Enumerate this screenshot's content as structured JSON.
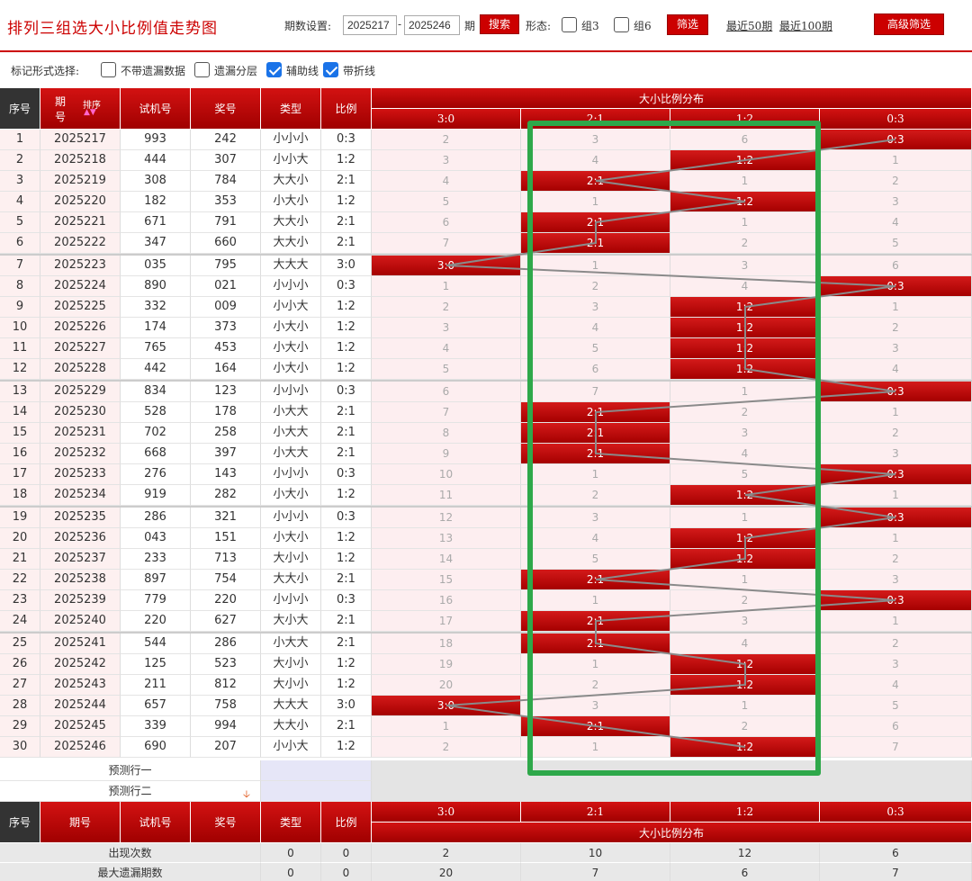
{
  "app": {
    "title": "排列三组选大小比例值走势图"
  },
  "filters": {
    "period_label": "期数设置:",
    "start": "2025217",
    "dash": "-",
    "end": "2025246",
    "unit": "期",
    "search_label": "搜索",
    "form_label": "形态:",
    "g3_label": "组3",
    "g6_label": "组6",
    "filter_label": "筛选",
    "recent50": "最近50期",
    "recent100": "最近100期",
    "advanced": "高级筛选"
  },
  "options": {
    "label": "标记形式选择:",
    "items": [
      {
        "label": "不带遗漏数据",
        "checked": false
      },
      {
        "label": "遗漏分层",
        "checked": false
      },
      {
        "label": "辅助线",
        "checked": true
      },
      {
        "label": "带折线",
        "checked": true
      }
    ]
  },
  "header": {
    "seq": "序号",
    "period_top": "期",
    "period_bottom": "号",
    "sort": "排序",
    "test": "试机号",
    "draw": "奖号",
    "type": "类型",
    "ratio": "比例",
    "dist": "大小比例分布",
    "cols": [
      "3:0",
      "2:1",
      "1:2",
      "0:3"
    ]
  },
  "rows": [
    {
      "seq": "1",
      "period": "2025217",
      "test": "993",
      "draw": "242",
      "type": "小小小",
      "ratio": "0:3",
      "cells": [
        "2",
        "3",
        "6",
        "0:3"
      ],
      "hit": 3
    },
    {
      "seq": "2",
      "period": "2025218",
      "test": "444",
      "draw": "307",
      "type": "小小大",
      "ratio": "1:2",
      "cells": [
        "3",
        "4",
        "1:2",
        "1"
      ],
      "hit": 2
    },
    {
      "seq": "3",
      "period": "2025219",
      "test": "308",
      "draw": "784",
      "type": "大大小",
      "ratio": "2:1",
      "cells": [
        "4",
        "2:1",
        "1",
        "2"
      ],
      "hit": 1
    },
    {
      "seq": "4",
      "period": "2025220",
      "test": "182",
      "draw": "353",
      "type": "小大小",
      "ratio": "1:2",
      "cells": [
        "5",
        "1",
        "1:2",
        "3"
      ],
      "hit": 2
    },
    {
      "seq": "5",
      "period": "2025221",
      "test": "671",
      "draw": "791",
      "type": "大大小",
      "ratio": "2:1",
      "cells": [
        "6",
        "2:1",
        "1",
        "4"
      ],
      "hit": 1
    },
    {
      "seq": "6",
      "period": "2025222",
      "test": "347",
      "draw": "660",
      "type": "大大小",
      "ratio": "2:1",
      "cells": [
        "7",
        "2:1",
        "2",
        "5"
      ],
      "hit": 1
    },
    {
      "seq": "7",
      "period": "2025223",
      "test": "035",
      "draw": "795",
      "type": "大大大",
      "ratio": "3:0",
      "cells": [
        "3:0",
        "1",
        "3",
        "6"
      ],
      "hit": 0
    },
    {
      "seq": "8",
      "period": "2025224",
      "test": "890",
      "draw": "021",
      "type": "小小小",
      "ratio": "0:3",
      "cells": [
        "1",
        "2",
        "4",
        "0:3"
      ],
      "hit": 3
    },
    {
      "seq": "9",
      "period": "2025225",
      "test": "332",
      "draw": "009",
      "type": "小小大",
      "ratio": "1:2",
      "cells": [
        "2",
        "3",
        "1:2",
        "1"
      ],
      "hit": 2
    },
    {
      "seq": "10",
      "period": "2025226",
      "test": "174",
      "draw": "373",
      "type": "小大小",
      "ratio": "1:2",
      "cells": [
        "3",
        "4",
        "1:2",
        "2"
      ],
      "hit": 2
    },
    {
      "seq": "11",
      "period": "2025227",
      "test": "765",
      "draw": "453",
      "type": "小大小",
      "ratio": "1:2",
      "cells": [
        "4",
        "5",
        "1:2",
        "3"
      ],
      "hit": 2
    },
    {
      "seq": "12",
      "period": "2025228",
      "test": "442",
      "draw": "164",
      "type": "小大小",
      "ratio": "1:2",
      "cells": [
        "5",
        "6",
        "1:2",
        "4"
      ],
      "hit": 2
    },
    {
      "seq": "13",
      "period": "2025229",
      "test": "834",
      "draw": "123",
      "type": "小小小",
      "ratio": "0:3",
      "cells": [
        "6",
        "7",
        "1",
        "0:3"
      ],
      "hit": 3
    },
    {
      "seq": "14",
      "period": "2025230",
      "test": "528",
      "draw": "178",
      "type": "小大大",
      "ratio": "2:1",
      "cells": [
        "7",
        "2:1",
        "2",
        "1"
      ],
      "hit": 1
    },
    {
      "seq": "15",
      "period": "2025231",
      "test": "702",
      "draw": "258",
      "type": "小大大",
      "ratio": "2:1",
      "cells": [
        "8",
        "2:1",
        "3",
        "2"
      ],
      "hit": 1
    },
    {
      "seq": "16",
      "period": "2025232",
      "test": "668",
      "draw": "397",
      "type": "小大大",
      "ratio": "2:1",
      "cells": [
        "9",
        "2:1",
        "4",
        "3"
      ],
      "hit": 1
    },
    {
      "seq": "17",
      "period": "2025233",
      "test": "276",
      "draw": "143",
      "type": "小小小",
      "ratio": "0:3",
      "cells": [
        "10",
        "1",
        "5",
        "0:3"
      ],
      "hit": 3
    },
    {
      "seq": "18",
      "period": "2025234",
      "test": "919",
      "draw": "282",
      "type": "小大小",
      "ratio": "1:2",
      "cells": [
        "11",
        "2",
        "1:2",
        "1"
      ],
      "hit": 2
    },
    {
      "seq": "19",
      "period": "2025235",
      "test": "286",
      "draw": "321",
      "type": "小小小",
      "ratio": "0:3",
      "cells": [
        "12",
        "3",
        "1",
        "0:3"
      ],
      "hit": 3
    },
    {
      "seq": "20",
      "period": "2025236",
      "test": "043",
      "draw": "151",
      "type": "小大小",
      "ratio": "1:2",
      "cells": [
        "13",
        "4",
        "1:2",
        "1"
      ],
      "hit": 2
    },
    {
      "seq": "21",
      "period": "2025237",
      "test": "233",
      "draw": "713",
      "type": "大小小",
      "ratio": "1:2",
      "cells": [
        "14",
        "5",
        "1:2",
        "2"
      ],
      "hit": 2
    },
    {
      "seq": "22",
      "period": "2025238",
      "test": "897",
      "draw": "754",
      "type": "大大小",
      "ratio": "2:1",
      "cells": [
        "15",
        "2:1",
        "1",
        "3"
      ],
      "hit": 1
    },
    {
      "seq": "23",
      "period": "2025239",
      "test": "779",
      "draw": "220",
      "type": "小小小",
      "ratio": "0:3",
      "cells": [
        "16",
        "1",
        "2",
        "0:3"
      ],
      "hit": 3
    },
    {
      "seq": "24",
      "period": "2025240",
      "test": "220",
      "draw": "627",
      "type": "大小大",
      "ratio": "2:1",
      "cells": [
        "17",
        "2:1",
        "3",
        "1"
      ],
      "hit": 1
    },
    {
      "seq": "25",
      "period": "2025241",
      "test": "544",
      "draw": "286",
      "type": "小大大",
      "ratio": "2:1",
      "cells": [
        "18",
        "2:1",
        "4",
        "2"
      ],
      "hit": 1
    },
    {
      "seq": "26",
      "period": "2025242",
      "test": "125",
      "draw": "523",
      "type": "大小小",
      "ratio": "1:2",
      "cells": [
        "19",
        "1",
        "1:2",
        "3"
      ],
      "hit": 2
    },
    {
      "seq": "27",
      "period": "2025243",
      "test": "211",
      "draw": "812",
      "type": "大小小",
      "ratio": "1:2",
      "cells": [
        "20",
        "2",
        "1:2",
        "4"
      ],
      "hit": 2
    },
    {
      "seq": "28",
      "period": "2025244",
      "test": "657",
      "draw": "758",
      "type": "大大大",
      "ratio": "3:0",
      "cells": [
        "3:0",
        "3",
        "1",
        "5"
      ],
      "hit": 0
    },
    {
      "seq": "29",
      "period": "2025245",
      "test": "339",
      "draw": "994",
      "type": "大大小",
      "ratio": "2:1",
      "cells": [
        "1",
        "2:1",
        "2",
        "6"
      ],
      "hit": 1
    },
    {
      "seq": "30",
      "period": "2025246",
      "test": "690",
      "draw": "207",
      "type": "小小大",
      "ratio": "1:2",
      "cells": [
        "2",
        "1",
        "1:2",
        "7"
      ],
      "hit": 2
    }
  ],
  "predict": {
    "row1": "预测行一",
    "row2": "预测行二"
  },
  "stats": [
    {
      "label": "出现次数",
      "type": "0",
      "ratio": "0",
      "cells": [
        "2",
        "10",
        "12",
        "6"
      ]
    },
    {
      "label": "最大遗漏期数",
      "type": "0",
      "ratio": "0",
      "cells": [
        "20",
        "7",
        "6",
        "7"
      ]
    }
  ],
  "colors": {
    "accent": "#c00000",
    "highlight_box": "#2ea84a",
    "checkbox": "#1a73e8"
  }
}
